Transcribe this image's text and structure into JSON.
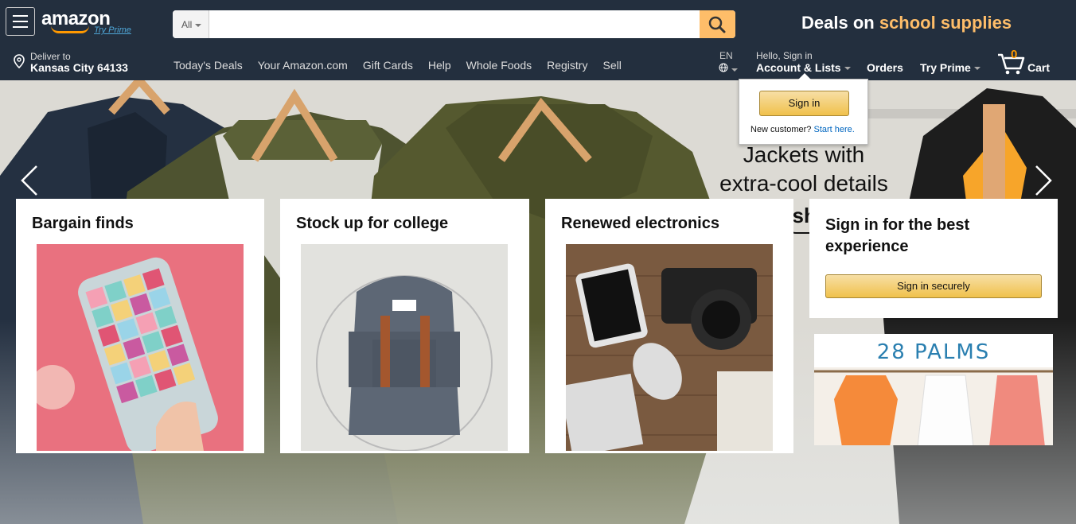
{
  "header": {
    "logo_text": "amazon",
    "logo_sub": "Try Prime",
    "search": {
      "category": "All",
      "placeholder": "",
      "value": ""
    },
    "promo": {
      "prefix": "Deals on",
      "highlight": "school supplies"
    },
    "deliver": {
      "line1": "Deliver to",
      "line2": "Kansas City 64133"
    },
    "nav_links": [
      "Today's Deals",
      "Your Amazon.com",
      "Gift Cards",
      "Help",
      "Whole Foods",
      "Registry",
      "Sell"
    ],
    "language": "EN",
    "account": {
      "line1": "Hello, Sign in",
      "line2": "Account & Lists"
    },
    "orders": "Orders",
    "try_prime": "Try Prime",
    "cart": {
      "count": "0",
      "label": "Cart"
    }
  },
  "signin_popup": {
    "button": "Sign in",
    "new_customer": "New customer?",
    "start_here": "Start here."
  },
  "hero": {
    "line1": "Jackets with",
    "line2": "extra-cool details",
    "brand": "Fashion"
  },
  "cards": [
    {
      "title": "Bargain finds"
    },
    {
      "title": "Stock up for college"
    },
    {
      "title": "Renewed electronics"
    }
  ],
  "signin_card": {
    "title": "Sign in for the best experience",
    "button": "Sign in securely"
  },
  "ad": {
    "brand": "28 PALMS"
  },
  "colors": {
    "nav_bg": "#232f3e",
    "accent": "#febd69",
    "orange": "#ff9900"
  }
}
